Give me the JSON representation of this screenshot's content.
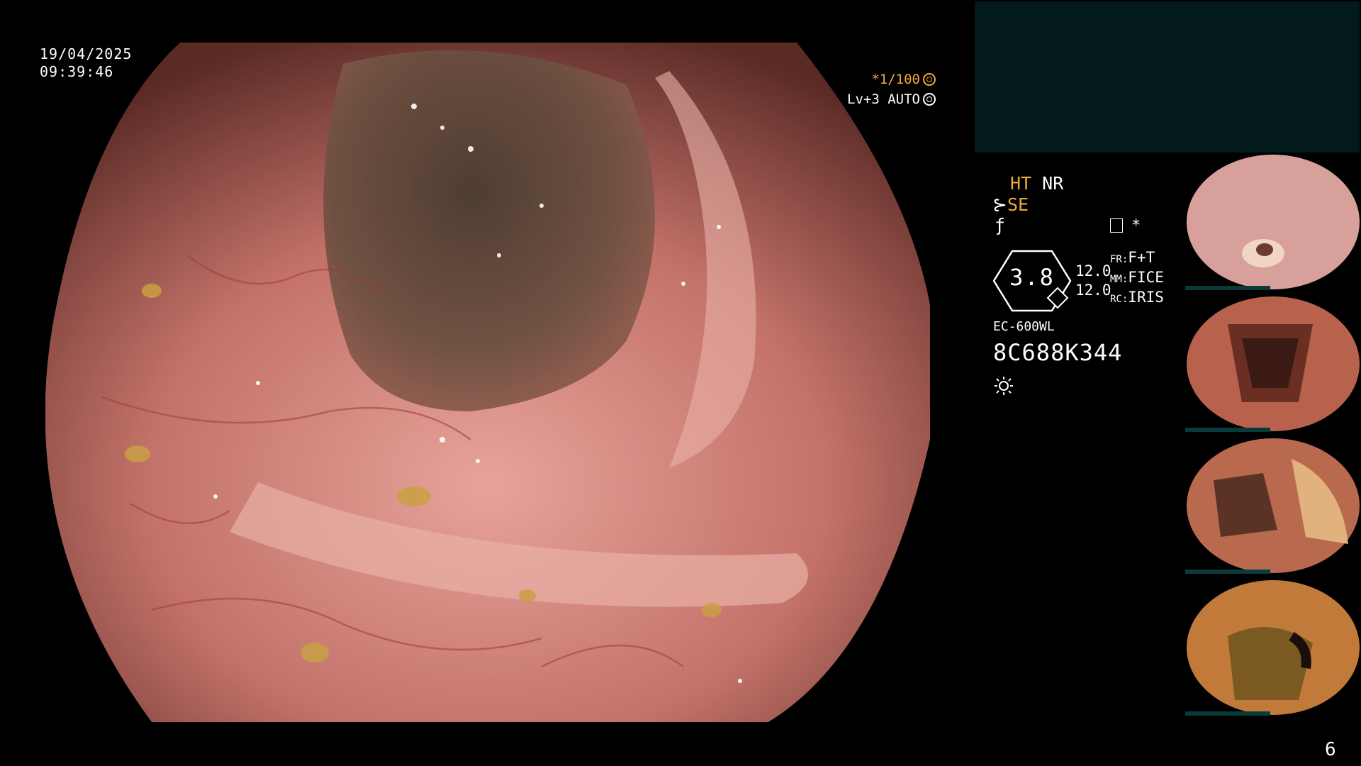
{
  "datetime": {
    "date": "19/04/2025",
    "time": "09:39:46"
  },
  "overlay": {
    "shutter": "*1/100",
    "level": "Lv+3 AUTO"
  },
  "panel": {
    "ht": "HT",
    "nr": "NR",
    "se": "SE",
    "tilde": "ƒ",
    "asterisk": "*",
    "gauge_value": "3.8",
    "nums": [
      "12.0",
      "12.0"
    ],
    "settings": [
      {
        "label": "FR:",
        "value": "F+T"
      },
      {
        "label": "MM:",
        "value": "FICE"
      },
      {
        "label": "RC:",
        "value": "IRIS"
      }
    ],
    "scope_model": "EC-600WL",
    "serial": "8C688K344"
  },
  "thumbnails": [
    {
      "label": "thumbnail-1"
    },
    {
      "label": "thumbnail-2"
    },
    {
      "label": "thumbnail-3"
    },
    {
      "label": "thumbnail-4"
    }
  ],
  "page_number": "6",
  "colors": {
    "accent": "#f2a93b",
    "panel_bg": "#031a1a",
    "mucosa": "#c9766f"
  }
}
